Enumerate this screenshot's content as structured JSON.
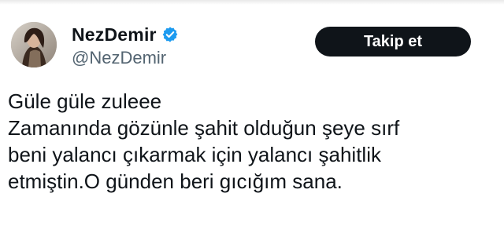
{
  "tweet": {
    "author": {
      "display_name": "NezDemir",
      "handle": "@NezDemir",
      "verified_icon": "verified-badge-icon",
      "avatar_icon": "profile-avatar"
    },
    "follow_label": "Takip et",
    "text_lines": [
      "Güle güle zuleee",
      "Zamanında gözünle şahit olduğun şeye sırf",
      "beni yalancı çıkarmak için yalancı şahitlik",
      "etmiştin.O günden beri gıcığım sana."
    ]
  },
  "colors": {
    "text_primary": "#0f1419",
    "text_secondary": "#536471",
    "verified_blue": "#1d9bf0",
    "button_dark": "#0f1419"
  }
}
